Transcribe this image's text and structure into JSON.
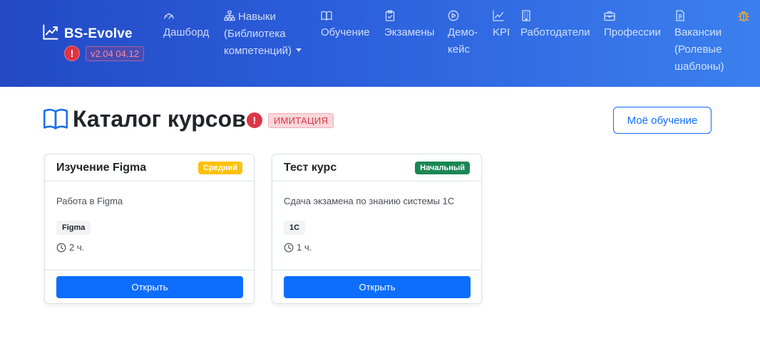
{
  "brand": {
    "name": "BS-Evolve",
    "version": "v2.04 04.12",
    "alert_symbol": "!"
  },
  "nav": {
    "dashboard": {
      "label": "Дашборд"
    },
    "skills": {
      "line1": "Навыки",
      "line2": "(Библиотека",
      "line3": "компетенций)"
    },
    "learning": {
      "label": "Обучение"
    },
    "exams": {
      "label": "Экзамены"
    },
    "democase": {
      "line1": "Демо-",
      "line2": "кейс"
    },
    "kpi": {
      "label": "KPI"
    },
    "employers": {
      "label": "Работодатели"
    },
    "professions": {
      "label": "Профессии"
    },
    "vacancies": {
      "line1": "Вакансии",
      "line2": "(Ролевые",
      "line3": "шаблоны)"
    }
  },
  "page": {
    "title": "Каталог курсов",
    "alert_symbol": "!",
    "imitation_badge": "ИМИТАЦИЯ",
    "my_learning_button": "Моё обучение"
  },
  "courses": [
    {
      "title": "Изучение Figma",
      "level": "Средний",
      "description": "Работа в Figma",
      "tag": "Figma",
      "duration": "2 ч.",
      "button": "Открыть"
    },
    {
      "title": "Тест курс",
      "level": "Начальный",
      "description": "Сдача экзамена по знанию системы 1С",
      "tag": "1С",
      "duration": "1 ч.",
      "button": "Открыть"
    }
  ],
  "colors": {
    "navbar_start": "#2349c4",
    "navbar_end": "#3b80ee",
    "primary": "#0d6efd",
    "danger": "#dc3545",
    "warning": "#ffc107",
    "success": "#198754"
  },
  "icons": {
    "brand": "graph-up-icon",
    "dashboard": "speedometer-icon",
    "skills": "diagram-icon",
    "learning": "book-icon",
    "exams": "clipboard-check-icon",
    "democase": "play-circle-icon",
    "kpi": "graph-up-icon",
    "employers": "building-icon",
    "professions": "briefcase-icon",
    "vacancies": "file-text-icon",
    "debug": "bug-icon",
    "page_title": "book-icon",
    "duration": "clock-icon"
  }
}
